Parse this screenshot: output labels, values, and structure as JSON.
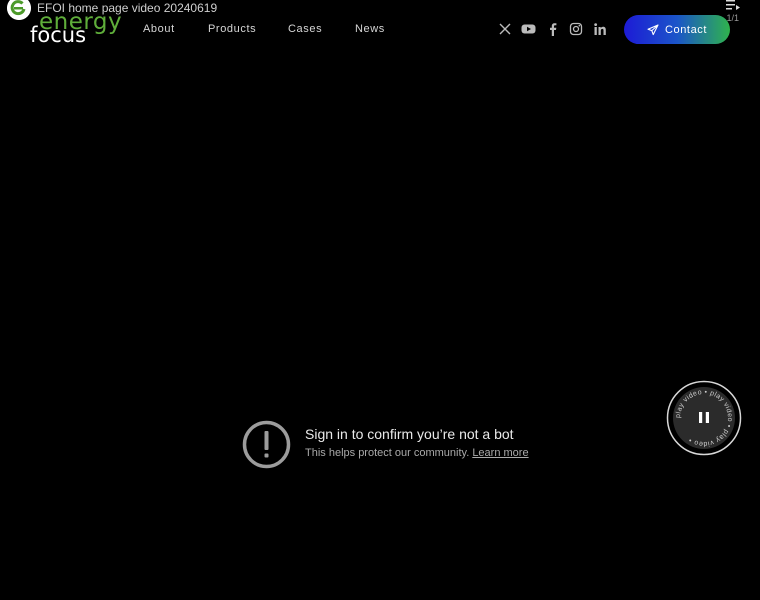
{
  "video": {
    "title": "EFOI home page video 20240619",
    "playlist_count": "1/1"
  },
  "logo": {
    "word_top": "energy",
    "word_bottom": "focus"
  },
  "nav": {
    "items": [
      {
        "label": "About"
      },
      {
        "label": "Products"
      },
      {
        "label": "Cases"
      },
      {
        "label": "News"
      }
    ]
  },
  "social": [
    "x-icon",
    "youtube-icon",
    "facebook-icon",
    "instagram-icon",
    "linkedin-icon"
  ],
  "contact": {
    "label": "Contact"
  },
  "bot_check": {
    "title": "Sign in to confirm you’re not a bot",
    "subtitle": "This helps protect our community.",
    "link": "Learn more"
  },
  "play_badge": {
    "ring_text": "play video • play video • play video •"
  },
  "colors": {
    "background": "#000000",
    "brand_green": "#5fae3a",
    "button_gradient_start": "#1d1bd6",
    "button_gradient_end": "#2fb34d"
  }
}
